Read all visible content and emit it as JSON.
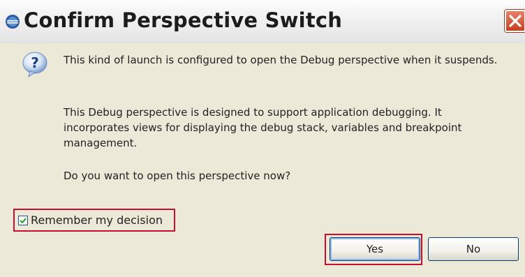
{
  "window": {
    "title": "Confirm Perspective Switch",
    "app_icon": "eclipse-icon",
    "close_icon": "close-icon"
  },
  "message": {
    "icon": "question-icon",
    "paragraph1": "This kind of launch is configured to open the Debug perspective when it suspends.",
    "paragraph2": "This Debug perspective is designed to support application debugging.  It incorporates views for displaying the debug stack, variables and breakpoint management.",
    "paragraph3": "Do you want to open this perspective now?"
  },
  "remember": {
    "label": "Remember my decision",
    "checked": true
  },
  "buttons": {
    "yes": "Yes",
    "no": "No"
  },
  "colors": {
    "highlight_border": "#c8102e",
    "dialog_background": "#ECE9D8",
    "close_button": "#c5401f"
  }
}
